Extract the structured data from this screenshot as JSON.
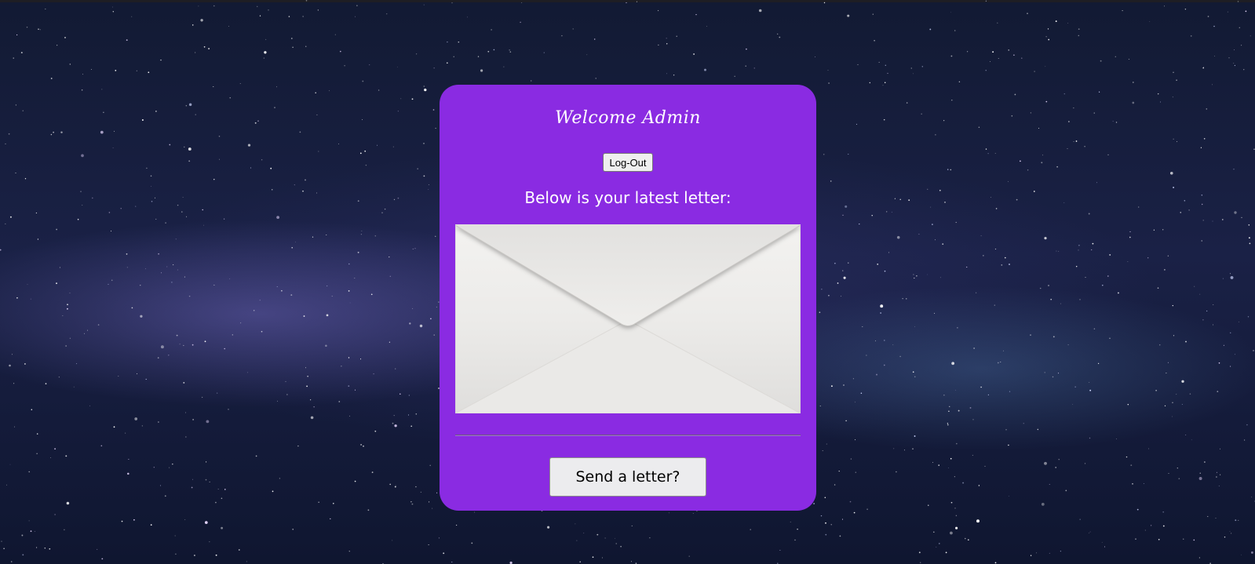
{
  "header": {
    "welcome": "Welcome Admin",
    "logout_label": "Log-Out"
  },
  "letter": {
    "intro": "Below is your latest letter:",
    "envelope_icon": "envelope-icon"
  },
  "actions": {
    "send_label": "Send a letter?"
  },
  "colors": {
    "card": "#8a2be2",
    "text": "#ffffff",
    "background": "#1a2146"
  }
}
